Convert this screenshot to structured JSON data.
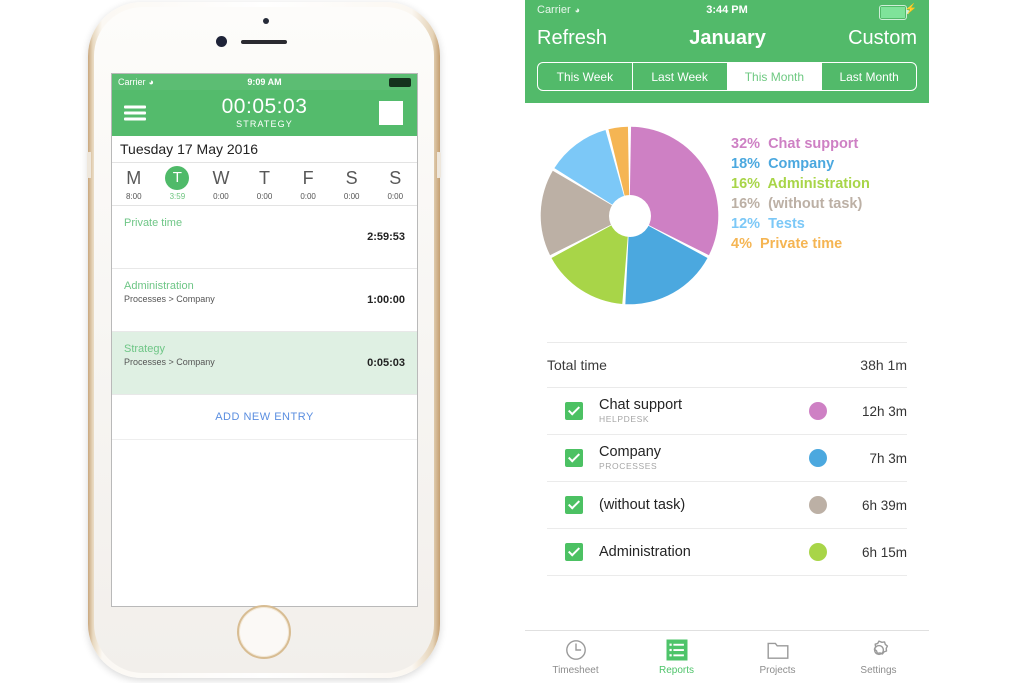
{
  "phone": {
    "status": {
      "carrier": "Carrier",
      "wifi_icon": "wifi-icon",
      "time": "9:09 AM",
      "battery_icon": "battery-full-icon"
    },
    "appbar": {
      "menu_icon": "hamburger-menu-icon",
      "timer": "00:05:03",
      "task": "STRATEGY",
      "stop_icon": "stop-square-icon"
    },
    "date_label": "Tuesday 17 May 2016",
    "week": [
      {
        "letter": "M",
        "hours": "8:00",
        "active": false
      },
      {
        "letter": "T",
        "hours": "3:59",
        "active": true
      },
      {
        "letter": "W",
        "hours": "0:00",
        "active": false
      },
      {
        "letter": "T",
        "hours": "0:00",
        "active": false
      },
      {
        "letter": "F",
        "hours": "0:00",
        "active": false
      },
      {
        "letter": "S",
        "hours": "0:00",
        "active": false
      },
      {
        "letter": "S",
        "hours": "0:00",
        "active": false
      }
    ],
    "entries": [
      {
        "title": "Private time",
        "sub": "",
        "duration": "2:59:53",
        "highlight": false
      },
      {
        "title": "Administration",
        "sub": "Processes > Company",
        "duration": "1:00:00",
        "highlight": false
      },
      {
        "title": "Strategy",
        "sub": "Processes > Company",
        "duration": "0:05:03",
        "highlight": true
      }
    ],
    "add_entry_label": "ADD NEW ENTRY"
  },
  "report": {
    "status": {
      "carrier": "Carrier",
      "wifi_icon": "wifi-icon",
      "time": "3:44 PM",
      "battery_icon": "battery-charging-icon",
      "bolt": "⚡"
    },
    "navbar": {
      "left": "Refresh",
      "title": "January",
      "right": "Custom"
    },
    "segments": [
      {
        "label": "This Week",
        "selected": false
      },
      {
        "label": "Last Week",
        "selected": false
      },
      {
        "label": "This Month",
        "selected": true
      },
      {
        "label": "Last Month",
        "selected": false
      }
    ],
    "total": {
      "label": "Total time",
      "value": "38h 1m"
    },
    "tasks": [
      {
        "name": "Chat support",
        "sub": "HELPDESK",
        "color": "#CE80C4",
        "duration": "12h 3m",
        "checked": true
      },
      {
        "name": "Company",
        "sub": "PROCESSES",
        "color": "#4BA8DF",
        "duration": "7h 3m",
        "checked": true
      },
      {
        "name": "(without task)",
        "sub": "",
        "color": "#BCB0A5",
        "duration": "6h 39m",
        "checked": true
      },
      {
        "name": "Administration",
        "sub": "",
        "color": "#A8D548",
        "duration": "6h 15m",
        "checked": true
      }
    ],
    "tabs": [
      {
        "label": "Timesheet",
        "icon": "clock-icon",
        "active": false
      },
      {
        "label": "Reports",
        "icon": "list-icon",
        "active": true
      },
      {
        "label": "Projects",
        "icon": "folder-icon",
        "active": false
      },
      {
        "label": "Settings",
        "icon": "gear-icon",
        "active": false
      }
    ],
    "theme": {
      "green": "#52BA6A",
      "accent_blue": "#5A8EE0"
    }
  },
  "chart_data": {
    "type": "pie",
    "title": "",
    "legend_position": "right",
    "categories": [
      "Chat support",
      "Company",
      "Administration",
      "(without task)",
      "Tests",
      "Private time"
    ],
    "values": [
      32,
      18,
      16,
      16,
      12,
      4
    ],
    "value_labels": [
      "32%",
      "18%",
      "16%",
      "16%",
      "12%",
      "4%"
    ],
    "colors": [
      "#CE80C4",
      "#4BA8DF",
      "#A8D548",
      "#BCB0A5",
      "#7CC8F7",
      "#F5B553"
    ],
    "legend": [
      {
        "pct": "32%",
        "label": "Chat support",
        "color": "#CE80C4"
      },
      {
        "pct": "18%",
        "label": "Company",
        "color": "#4BA8DF"
      },
      {
        "pct": "16%",
        "label": "Administration",
        "color": "#A8D548"
      },
      {
        "pct": "16%",
        "label": "(without task)",
        "color": "#BCB0A5"
      },
      {
        "pct": "12%",
        "label": "Tests",
        "color": "#7CC8F7"
      },
      {
        "pct": "4%",
        "label": "Private time",
        "color": "#F5B553"
      }
    ],
    "donut": true,
    "start_angle_deg": 0,
    "gap_deg": 2
  }
}
